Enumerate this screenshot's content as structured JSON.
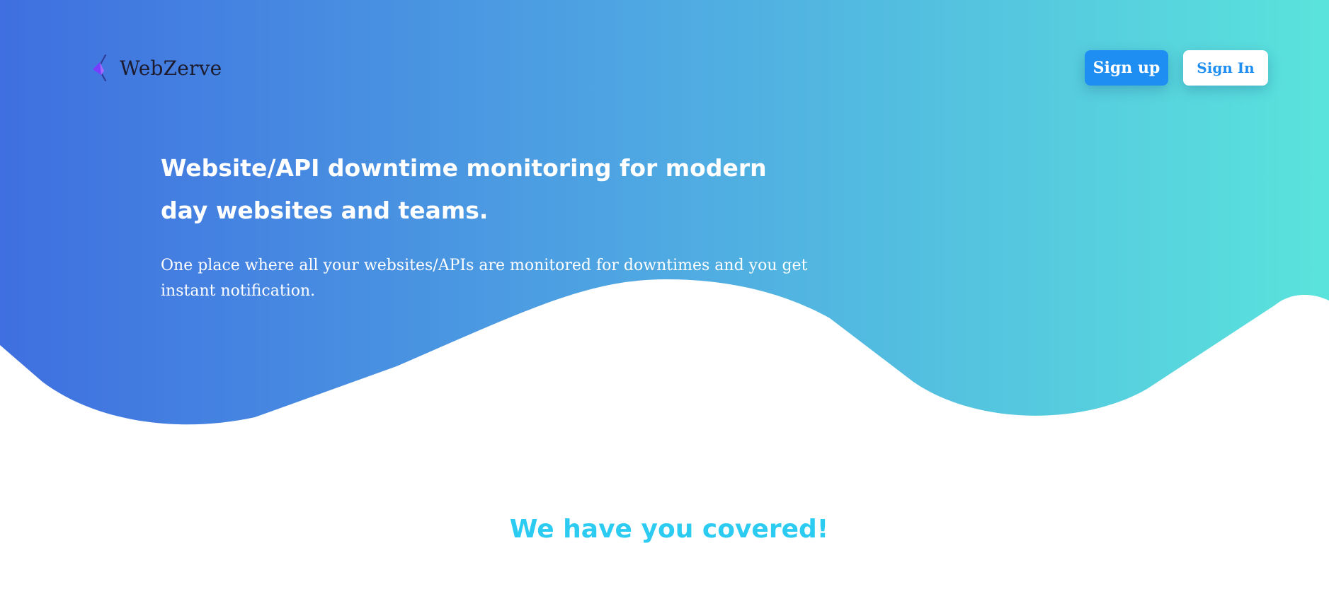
{
  "brand": {
    "name": "WebZerve",
    "logo_icon": "webzerve-logo-icon"
  },
  "header": {
    "signup_label": "Sign up",
    "signin_label": "Sign In"
  },
  "hero": {
    "headline": "Website/API downtime monitoring for modern day websites and teams.",
    "subtext": "One place where all your websites/APIs are monitored for downtimes and you get instant notification."
  },
  "section": {
    "title": "We have you covered!"
  },
  "colors": {
    "gradient_start": "#3f6fe0",
    "gradient_end": "#5ae3dc",
    "primary_button": "#1f8ef2",
    "section_title": "#2ccbf2"
  }
}
